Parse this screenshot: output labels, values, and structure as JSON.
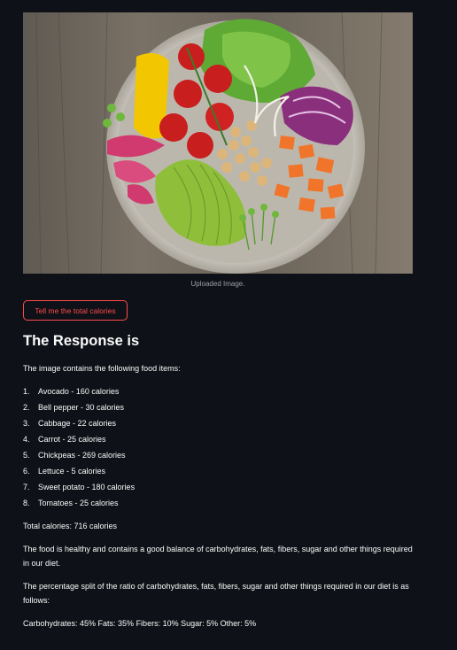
{
  "image": {
    "caption": "Uploaded Image."
  },
  "button": {
    "label": "Tell me the total calories"
  },
  "response": {
    "heading": "The Response is",
    "intro": "The image contains the following food items:",
    "items": [
      {
        "num": "1.",
        "text": "Avocado - 160 calories"
      },
      {
        "num": "2.",
        "text": "Bell pepper - 30 calories"
      },
      {
        "num": "3.",
        "text": "Cabbage - 22 calories"
      },
      {
        "num": "4.",
        "text": "Carrot - 25 calories"
      },
      {
        "num": "5.",
        "text": "Chickpeas - 269 calories"
      },
      {
        "num": "6.",
        "text": "Lettuce - 5 calories"
      },
      {
        "num": "7.",
        "text": "Sweet potato - 180 calories"
      },
      {
        "num": "8.",
        "text": "Tomatoes - 25 calories"
      }
    ],
    "total": "Total calories: 716 calories",
    "health_note": "The food is healthy and contains a good balance of carbohydrates, fats, fibers, sugar and other things required in our diet.",
    "split_intro": "The percentage split of the ratio of carbohydrates, fats, fibers, sugar and other things required in our diet is as follows:",
    "split": "Carbohydrates: 45% Fats: 35% Fibers: 10% Sugar: 5% Other: 5%"
  },
  "colors": {
    "background": "#0e1117",
    "accent": "#ff4b4b",
    "text": "#fafafa"
  }
}
